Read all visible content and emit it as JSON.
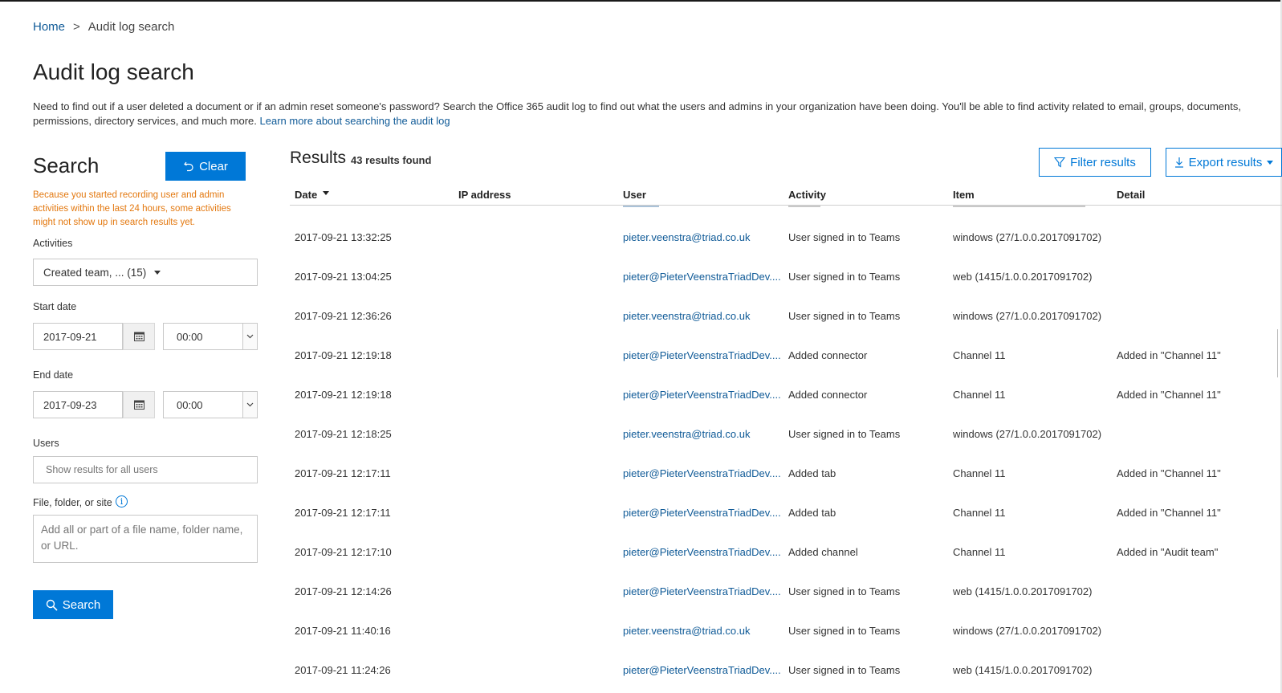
{
  "breadcrumb": {
    "home": "Home",
    "separator": ">",
    "current": "Audit log search"
  },
  "page": {
    "title": "Audit log search",
    "intro": "Need to find out if a user deleted a document or if an admin reset someone's password? Search the Office 365 audit log to find out what the users and admins in your organization have been doing. You'll be able to find activity related to email, groups, documents, permissions, directory services, and much more.",
    "learn_more": "Learn more about searching the audit log"
  },
  "search_panel": {
    "heading": "Search",
    "clear_label": "Clear",
    "warning": "Because you started recording user and admin activities within the last 24 hours, some activities might not show up in search results yet.",
    "activities_label": "Activities",
    "activities_value": "Created team, ... (15)",
    "start_date_label": "Start date",
    "start_date": "2017-09-21",
    "start_time": "00:00",
    "end_date_label": "End date",
    "end_date": "2017-09-23",
    "end_time": "00:00",
    "users_label": "Users",
    "users_placeholder": "Show results for all users",
    "file_label": "File, folder, or site",
    "file_placeholder": "Add all or part of a file name, folder name, or URL.",
    "search_label": "Search"
  },
  "results": {
    "title": "Results",
    "count": "43 results found",
    "filter_label": "Filter results",
    "export_label": "Export results",
    "columns": [
      "Date",
      "IP address",
      "User",
      "Activity",
      "Item",
      "Detail"
    ],
    "rows": [
      {
        "date": "2017-09-21 13:32:25",
        "ip": "",
        "user": "pieter.veenstra@triad.co.uk",
        "activity": "User signed in to Teams",
        "item": "windows (27/1.0.0.2017091702)",
        "detail": ""
      },
      {
        "date": "2017-09-21 13:04:25",
        "ip": "",
        "user": "pieter@PieterVeenstraTriadDev....",
        "activity": "User signed in to Teams",
        "item": "web (1415/1.0.0.2017091702)",
        "detail": ""
      },
      {
        "date": "2017-09-21 12:36:26",
        "ip": "",
        "user": "pieter.veenstra@triad.co.uk",
        "activity": "User signed in to Teams",
        "item": "windows (27/1.0.0.2017091702)",
        "detail": ""
      },
      {
        "date": "2017-09-21 12:19:18",
        "ip": "",
        "user": "pieter@PieterVeenstraTriadDev....",
        "activity": "Added connector",
        "item": "Channel 11",
        "detail": "Added in \"Channel 11\""
      },
      {
        "date": "2017-09-21 12:19:18",
        "ip": "",
        "user": "pieter@PieterVeenstraTriadDev....",
        "activity": "Added connector",
        "item": "Channel 11",
        "detail": "Added in \"Channel 11\""
      },
      {
        "date": "2017-09-21 12:18:25",
        "ip": "",
        "user": "pieter.veenstra@triad.co.uk",
        "activity": "User signed in to Teams",
        "item": "windows (27/1.0.0.2017091702)",
        "detail": ""
      },
      {
        "date": "2017-09-21 12:17:11",
        "ip": "",
        "user": "pieter@PieterVeenstraTriadDev....",
        "activity": "Added tab",
        "item": "Channel 11",
        "detail": "Added in \"Channel 11\""
      },
      {
        "date": "2017-09-21 12:17:11",
        "ip": "",
        "user": "pieter@PieterVeenstraTriadDev....",
        "activity": "Added tab",
        "item": "Channel 11",
        "detail": "Added in \"Channel 11\""
      },
      {
        "date": "2017-09-21 12:17:10",
        "ip": "",
        "user": "pieter@PieterVeenstraTriadDev....",
        "activity": "Added channel",
        "item": "Channel 11",
        "detail": "Added in \"Audit team\""
      },
      {
        "date": "2017-09-21 12:14:26",
        "ip": "",
        "user": "pieter@PieterVeenstraTriadDev....",
        "activity": "User signed in to Teams",
        "item": "web (1415/1.0.0.2017091702)",
        "detail": ""
      },
      {
        "date": "2017-09-21 11:40:16",
        "ip": "",
        "user": "pieter.veenstra@triad.co.uk",
        "activity": "User signed in to Teams",
        "item": "windows (27/1.0.0.2017091702)",
        "detail": ""
      },
      {
        "date": "2017-09-21 11:24:26",
        "ip": "",
        "user": "pieter@PieterVeenstraTriadDev....",
        "activity": "User signed in to Teams",
        "item": "web (1415/1.0.0.2017091702)",
        "detail": ""
      }
    ]
  },
  "colors": {
    "accent": "#0078d7",
    "link": "#0f5a97",
    "warning": "#e3780f"
  },
  "icons": {
    "clear": "undo-icon",
    "calendar": "calendar-icon",
    "info": "info-icon",
    "search": "search-icon",
    "filter": "filter-icon",
    "export": "download-icon"
  }
}
